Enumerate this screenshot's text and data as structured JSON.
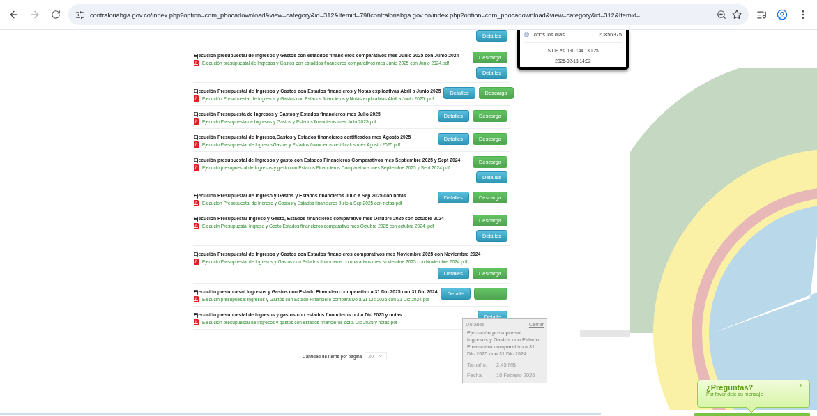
{
  "browser": {
    "url": "contraloriabga.gov.co/index.php?option=com_phocadownload&view=category&id=312&Itemid=798contraloriabga.gov.co/index.php?option=com_phocadownload&view=category&id=312&Itemid=..."
  },
  "documents": [
    {
      "kind": "partial",
      "buttons": [
        {
          "kind": "details",
          "label": "Detalles"
        }
      ]
    },
    {
      "kind": "stacked",
      "title": "Ejecución presupuestal de Ingresos y Gastos con estaddos financieros comparativos mes Junio 2025 con Junio 2024",
      "file": "Ejecución presupuestal de Ingresos y Gastos con estaddos financieros comparativos mes Junio 2025 con Junio 2024.pdf",
      "buttons": [
        {
          "kind": "download",
          "label": "Descarga"
        },
        {
          "kind": "details",
          "label": "Detalles"
        }
      ]
    },
    {
      "kind": "inline",
      "title": "Ejecución Presupuestal de Ingresos y Gastos con Estados financieros y Notas explicativas Abril a Junio 2025",
      "file": "Ejecución Presupuestal de Ingresos y Gastos con Estados financieros y Notas explicativas Abril a Junio 2025 .pdf",
      "buttons": [
        {
          "kind": "details",
          "label": "Detalles"
        },
        {
          "kind": "download",
          "label": "Descarga"
        }
      ]
    },
    {
      "kind": "inline",
      "title": "Ejecución Presupuesta de Ingresos y Gastos y Estados financieros mes Julio 2025",
      "file": "Ejecucin Presupuesta de Ingresos y Gastos y Estados financieros mes Julio 2025.pdf",
      "buttons": [
        {
          "kind": "details",
          "label": "Detalles"
        },
        {
          "kind": "download",
          "label": "Descarga"
        }
      ]
    },
    {
      "kind": "inline",
      "title": "Ejecución Presupuestal de Ingresos,Gastos y Estados financieros certificados mes Agosto 2025",
      "file": "Ejecucin Presupuestal de IngresosGastos y Estados financieros certificafos mes Agosto 2025.pdf",
      "buttons": [
        {
          "kind": "details",
          "label": "Detalles"
        },
        {
          "kind": "download",
          "label": "Descarga"
        }
      ]
    },
    {
      "kind": "stacked",
      "title": "Ejecución presupuestal de Ingresos y gasto con Estados Financieros Comparativos mes Septiembre 2025 y Sept 2024",
      "file": "Ejecucin presupuestal de Ingresos y gasto con Estados Financieros Comparativos mes Septiembre 2025 y Sept 2024.pdf",
      "buttons": [
        {
          "kind": "download",
          "label": "Descarga"
        },
        {
          "kind": "details",
          "label": "Detalles"
        }
      ]
    },
    {
      "kind": "inline",
      "title": "Ejecucion Presupuestal de Ingreso y Gastos y Estados financieros Julio a Sep 2025 con notas",
      "file": "Ejecucion Presupuestal de Ingreso y Gastos y Estados financieros Julio a Sep 2025 con notas.pdf",
      "buttons": [
        {
          "kind": "details",
          "label": "Detalles"
        },
        {
          "kind": "download",
          "label": "Descarga"
        }
      ]
    },
    {
      "kind": "stacked",
      "title": "Ejecución Presupuestal Ingreso y Gasto, Estados financieros comparativo mes Octubre 2025 con octubre 2024",
      "file": "Ejecucin Presupuestal Ingreso y Gasto Estados financieros comparativo mes Octubre 2025 con octubre 2024 .pdf",
      "buttons": [
        {
          "kind": "download",
          "label": "Descarga"
        },
        {
          "kind": "details",
          "label": "Detalles"
        }
      ]
    },
    {
      "kind": "below",
      "title": "Ejecución Presupuestal de Ingresos y Gastos con Estados financieros comparativos mes Noviembre 2025 con Noviembre 2024",
      "file": "Ejecucin Presupuestal de Ingresos y Gastos con Estados financieros comparativos mes Noviembre 2025 con Noviembre 2024.pdf",
      "buttons": [
        {
          "kind": "details",
          "label": "Detalles"
        },
        {
          "kind": "download",
          "label": "Descarga"
        }
      ]
    },
    {
      "kind": "inline",
      "title": "Ejecución presupuesal Ingresos y Gastos con Estado Financiero comparativo a 31 Dic 2025 con 31 Dic 2024",
      "file": "Ejecucin presupuesal Ingresos y Gastos con Estado Financiero comparativo a 31 Dic 2025 con 31 Dic 2024.pdf",
      "buttons": [
        {
          "kind": "details",
          "label": "Detalle"
        },
        {
          "kind": "download"
        }
      ]
    },
    {
      "kind": "inline",
      "title": "Ejecución presupuestal de ingresos y gastos con estados financieros oct a Dic 2025 y notas",
      "file": "Ejecución presupuestal de ingresos y gastos con estados financieros oct a Dic 2025 y notas.pdf",
      "buttons": [
        {
          "kind": "details",
          "label": "Detalle"
        }
      ]
    }
  ],
  "tooltip": {
    "title": "Detalles",
    "close": "Cerrar",
    "name": "Ejecución presupuesal Ingresos y Gastos con Estado Financiero comparativo a 31 Dic 2025 con 31 Dic 2024",
    "fields": [
      {
        "label": "Tamaño:",
        "value": "2.45 MB"
      },
      {
        "label": "Fecha:",
        "value": "10 Febrero 2026"
      }
    ]
  },
  "pagination": {
    "label": "Cantidad de ítems por página",
    "value": "20"
  },
  "stats": {
    "row_label": "Todos los días",
    "row_value": "20856375",
    "ip": "Su IP es: 190.144.130.25",
    "datetime": "2026-02-13 14:32"
  },
  "chat": {
    "title": "¿Preguntas?",
    "subtitle": "Por favor deje su mensaje",
    "close": "x"
  }
}
